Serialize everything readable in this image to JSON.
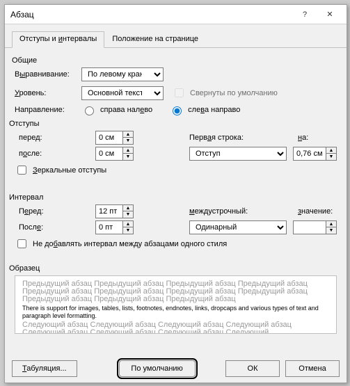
{
  "title": "Абзац",
  "help_glyph": "?",
  "close_glyph": "✕",
  "tabs": {
    "indent": "Отступы и интервалы",
    "position": "Положение на странице"
  },
  "general": {
    "heading": "Общие",
    "align_label_pre": "В",
    "align_label_u": "ы",
    "align_label_post": "равнивание:",
    "align_value": "По левому краю",
    "level_label_pre": "",
    "level_label_u": "У",
    "level_label_post": "ровень:",
    "level_value": "Основной текст",
    "collapse_label": "Свернуты по умолчанию",
    "direction_label": "Направление:",
    "rtl_label_pre": "справа нал",
    "rtl_label_u": "е",
    "rtl_label_post": "во",
    "ltr_label_pre": "сле",
    "ltr_label_u": "в",
    "ltr_label_post": "а направо"
  },
  "indent": {
    "heading": "Отступы",
    "before_label_pre": "пере",
    "before_label_u": "д",
    "before_label_post": ":",
    "before_value": "0 см",
    "after_label_pre": "п",
    "after_label_u": "о",
    "after_label_post": "сле:",
    "after_value": "0 см",
    "firstline_label_pre": "Перв",
    "firstline_label_u": "а",
    "firstline_label_post": "я строка:",
    "firstline_value": "Отступ",
    "by_label_pre": "",
    "by_label_u": "н",
    "by_label_post": "а:",
    "by_value": "0,76 см",
    "mirror_label_pre": "",
    "mirror_label_u": "З",
    "mirror_label_post": "еркальные отступы"
  },
  "spacing": {
    "heading": "Интервал",
    "before_label_pre": "П",
    "before_label_u": "е",
    "before_label_post": "ред:",
    "before_value": "12 пт",
    "after_label_pre": "Посл",
    "after_label_u": "е",
    "after_label_post": ":",
    "after_value": "0 пт",
    "linesp_label_pre": "",
    "linesp_label_u": "м",
    "linesp_label_post": "еждустрочный:",
    "linesp_value": "Одинарный",
    "at_label_pre": "",
    "at_label_u": "з",
    "at_label_post": "начение:",
    "at_value": "",
    "nosame_label_pre": "Не до",
    "nosame_label_u": "б",
    "nosame_label_post": "авлять интервал между абзацами одного стиля"
  },
  "preview": {
    "heading": "Образец",
    "prev_text": "Предыдущий абзац Предыдущий абзац Предыдущий абзац Предыдущий абзац Предыдущий абзац Предыдущий абзац Предыдущий абзац Предыдущий абзац Предыдущий абзац Предыдущий абзац Предыдущий абзац",
    "sample_text": "There is support for images, tables, lists, footnotes, endnotes, links, dropcaps and various types of text and paragraph level formatting.",
    "next_text": "Следующий абзац Следующий абзац Следующий абзац Следующий абзац Следующий абзац Следующий абзац Следующий абзац Следующий"
  },
  "footer": {
    "tabs_btn_pre": "",
    "tabs_btn_u": "Т",
    "tabs_btn_post": "абуляция...",
    "default_btn": "По умолчанию",
    "ok_btn": "ОК",
    "cancel_btn": "Отмена"
  }
}
